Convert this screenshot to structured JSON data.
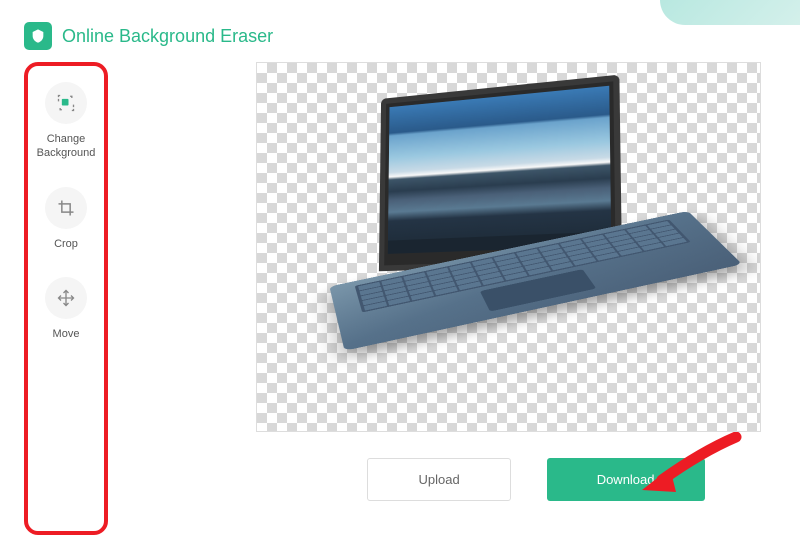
{
  "header": {
    "title": "Online Background Eraser"
  },
  "sidebar": {
    "items": [
      {
        "label": "Change\nBackground",
        "icon": "change-background-icon"
      },
      {
        "label": "Crop",
        "icon": "crop-icon"
      },
      {
        "label": "Move",
        "icon": "move-icon"
      }
    ]
  },
  "actions": {
    "upload_label": "Upload",
    "download_label": "Download"
  },
  "colors": {
    "brand": "#2ab98a",
    "annotation": "#ed1c24"
  }
}
